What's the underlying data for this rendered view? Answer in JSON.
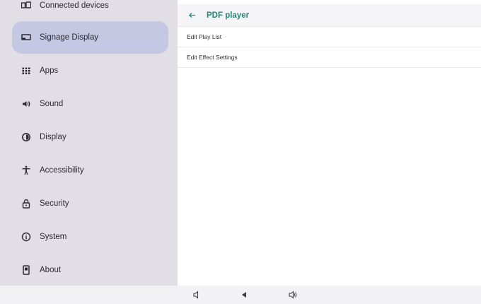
{
  "sidebar": {
    "items": [
      {
        "label": "Connected devices",
        "icon": "connected-devices-icon"
      },
      {
        "label": "Signage Display",
        "icon": "signage-display-icon",
        "selected": true
      },
      {
        "label": "Apps",
        "icon": "apps-grid-icon"
      },
      {
        "label": "Sound",
        "icon": "speaker-icon"
      },
      {
        "label": "Display",
        "icon": "brightness-icon"
      },
      {
        "label": "Accessibility",
        "icon": "accessibility-icon"
      },
      {
        "label": "Security",
        "icon": "lock-icon"
      },
      {
        "label": "System",
        "icon": "info-icon"
      },
      {
        "label": "About",
        "icon": "tablet-icon"
      }
    ]
  },
  "header": {
    "title": "PDF player",
    "back_icon": "arrow-left-icon"
  },
  "main": {
    "rows": [
      {
        "label": "Edit Play List"
      },
      {
        "label": "Edit Effect Settings"
      }
    ]
  },
  "navbar": {
    "buttons": [
      "volume-down-icon",
      "back-triangle-icon",
      "volume-up-icon"
    ]
  },
  "colors": {
    "accent": "#1e8a79",
    "sidebar_bg": "#e2dee6",
    "selected_bg": "#c4c8e2"
  }
}
